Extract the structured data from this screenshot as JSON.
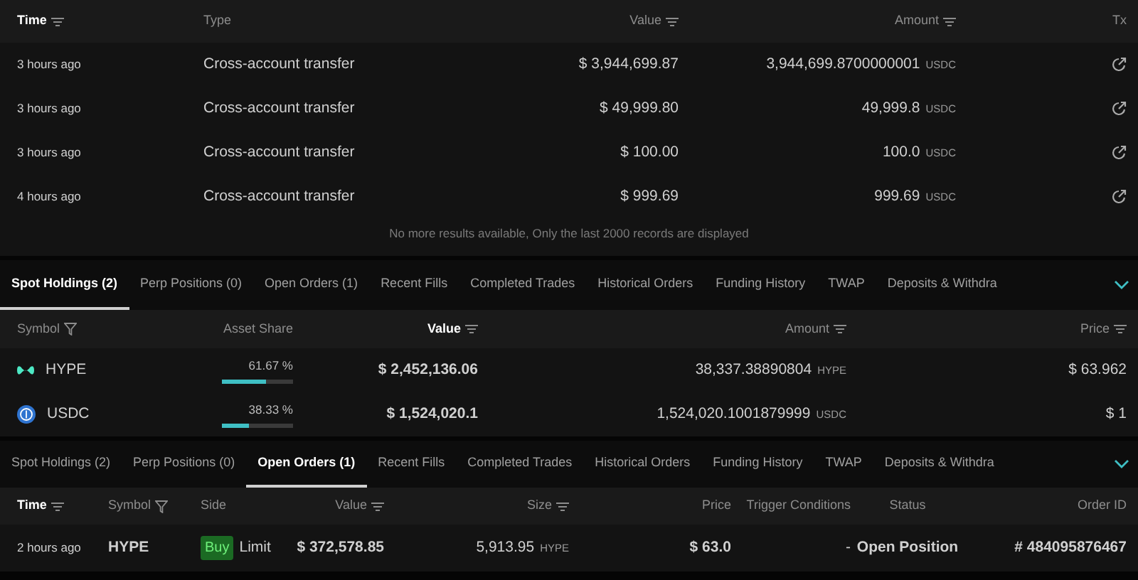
{
  "transfers": {
    "columns": [
      {
        "label": "Time",
        "active": true
      },
      {
        "label": "Type",
        "active": false
      },
      {
        "label": "Value",
        "active": false
      },
      {
        "label": "Amount",
        "active": false
      },
      {
        "label": "Tx",
        "active": false
      }
    ],
    "rows": [
      {
        "time": "3 hours ago",
        "type": "Cross-account transfer",
        "value": "$ 3,944,699.87",
        "amount": "3,944,699.8700000001",
        "unit": "USDC"
      },
      {
        "time": "3 hours ago",
        "type": "Cross-account transfer",
        "value": "$ 49,999.80",
        "amount": "49,999.8",
        "unit": "USDC"
      },
      {
        "time": "3 hours ago",
        "type": "Cross-account transfer",
        "value": "$ 100.00",
        "amount": "100.0",
        "unit": "USDC"
      },
      {
        "time": "4 hours ago",
        "type": "Cross-account transfer",
        "value": "$ 999.69",
        "amount": "999.69",
        "unit": "USDC"
      }
    ],
    "note": "No more results available, Only the last 2000 records are displayed"
  },
  "holdings": {
    "tabs": [
      {
        "label": "Spot Holdings (2)",
        "selected": true
      },
      {
        "label": "Perp Positions (0)",
        "selected": false
      },
      {
        "label": "Open Orders (1)",
        "selected": false
      },
      {
        "label": "Recent Fills",
        "selected": false
      },
      {
        "label": "Completed Trades",
        "selected": false
      },
      {
        "label": "Historical Orders",
        "selected": false
      },
      {
        "label": "Funding History",
        "selected": false
      },
      {
        "label": "TWAP",
        "selected": false
      },
      {
        "label": "Deposits & Withdra",
        "selected": false
      }
    ],
    "columns": [
      {
        "label": "Symbol",
        "active": false
      },
      {
        "label": "Asset Share",
        "active": false
      },
      {
        "label": "Value",
        "active": true
      },
      {
        "label": "Amount",
        "active": false
      },
      {
        "label": "Price",
        "active": false
      }
    ],
    "rows": [
      {
        "kind": "hype",
        "symbol": "HYPE",
        "share": "61.67 %",
        "level": 0.6167,
        "value": "$ 2,452,136.06",
        "amount": "38,337.38890804",
        "unit": "HYPE",
        "price": "$ 63.962"
      },
      {
        "kind": "usdc",
        "symbol": "USDC",
        "share": "38.33 %",
        "level": 0.3833,
        "value": "$ 1,524,020.1",
        "amount": "1,524,020.1001879999",
        "unit": "USDC",
        "price": "$ 1"
      }
    ]
  },
  "orders": {
    "tabs": [
      {
        "label": "Spot Holdings (2)",
        "selected": false
      },
      {
        "label": "Perp Positions (0)",
        "selected": false
      },
      {
        "label": "Open Orders (1)",
        "selected": true
      },
      {
        "label": "Recent Fills",
        "selected": false
      },
      {
        "label": "Completed Trades",
        "selected": false
      },
      {
        "label": "Historical Orders",
        "selected": false
      },
      {
        "label": "Funding History",
        "selected": false
      },
      {
        "label": "TWAP",
        "selected": false
      },
      {
        "label": "Deposits & Withdra",
        "selected": false
      }
    ],
    "columns": [
      {
        "label": "Time",
        "active": true
      },
      {
        "label": "Symbol",
        "active": false
      },
      {
        "label": "Side",
        "active": false
      },
      {
        "label": "Value",
        "active": false
      },
      {
        "label": "Size",
        "active": false
      },
      {
        "label": "Price",
        "active": false
      },
      {
        "label": "Trigger Conditions",
        "active": false
      },
      {
        "label": "Status",
        "active": false
      },
      {
        "label": "Order ID",
        "active": false
      }
    ],
    "rows": [
      {
        "time": "2 hours ago",
        "symbol": "HYPE",
        "side": "Buy",
        "side_buy": true,
        "order_type": "Limit",
        "value": "$ 372,578.85",
        "size": "5,913.95",
        "unit": "HYPE",
        "price": "$ 63.0",
        "trigger": "-",
        "status": "Open Position",
        "order_id": "# 484095876467"
      }
    ]
  }
}
